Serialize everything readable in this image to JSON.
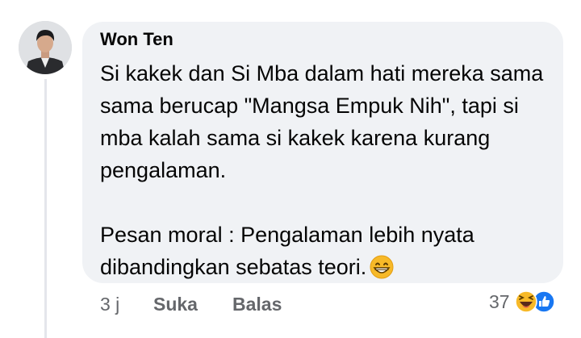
{
  "comment": {
    "author": "Won Ten",
    "body_lines": [
      "Si kakek dan Si Mba dalam hati mereka sama sama berucap \"Mangsa Empuk Nih\", tapi si mba kalah sama si kakek karena kurang pengalaman.",
      "Pesan moral : Pengalaman lebih nyata dibandingkan sebatas teori."
    ],
    "inline_emoji_icon": "grinning-face-icon",
    "time": "3 j",
    "like_label": "Suka",
    "reply_label": "Balas",
    "reaction_count": "37",
    "reaction_icons": [
      "haha-reaction-icon",
      "like-reaction-icon"
    ]
  },
  "colors": {
    "bubble": "#f0f2f5",
    "secondary_text": "#65676b",
    "like_blue": "#1877f2",
    "emoji_yellow": "#f7b928"
  }
}
